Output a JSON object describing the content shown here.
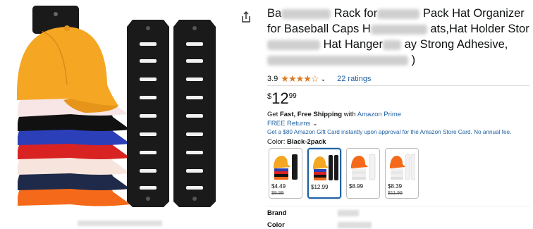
{
  "product": {
    "title_parts": [
      "Ba",
      "Rack for",
      "Pack Hat Organizer for",
      "Baseball Caps H",
      "ats,Hat Holder",
      "Stor",
      "Hat Hanger",
      "ay Strong",
      "Adhesive,",
      ")"
    ],
    "rating_value": "3.9",
    "ratings_count": "22 ratings",
    "price_symbol": "$",
    "price_whole": "12",
    "price_fraction": "99",
    "shipping_bold": "Fast, Free Shipping",
    "shipping_prefix": "Get",
    "shipping_with": "with",
    "prime_link": "Amazon Prime",
    "returns": "FREE Returns",
    "gift_card": "Get a $80 Amazon Gift Card instantly upon approval for the Amazon Store Card. No annual fee.",
    "color_label": "Color:",
    "color_value": "Black-2pack",
    "brand_label": "Brand",
    "color_row_label": "Color"
  },
  "swatches": [
    {
      "price": "$4.49",
      "strike": "$8.99",
      "selected": false
    },
    {
      "price": "$12.99",
      "strike": "",
      "selected": true
    },
    {
      "price": "$8.99",
      "strike": "",
      "selected": false
    },
    {
      "price": "$8.39",
      "strike": "$11.99",
      "selected": false
    }
  ],
  "colors": {
    "link": "#2162a1",
    "star": "#de7921",
    "rack": "#1a1a1a",
    "cap_yellow": "#f5a623"
  },
  "icons": [
    "share-icon",
    "chevron-down-icon",
    "star-icon"
  ]
}
